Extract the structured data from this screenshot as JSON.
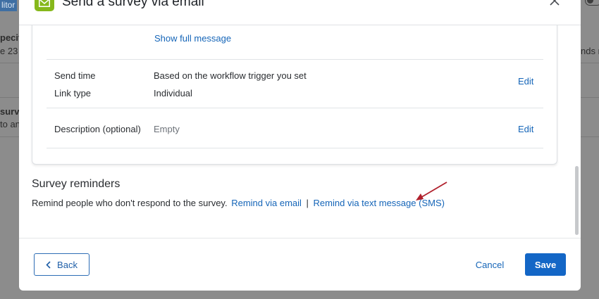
{
  "background": {
    "top_button_label": "litor",
    "fragments": [
      "pecifi",
      "e 23",
      "nds n",
      "surv",
      "to an"
    ],
    "toggle_icon": "toggle-icon"
  },
  "modal": {
    "title": "Send a survey via email",
    "icon": "envelope-icon",
    "close_icon": "close-icon",
    "accent_color": "#86b81b",
    "card": {
      "show_full_message": "Show full message",
      "rows": [
        {
          "label": "Send time",
          "value": "Based on the workflow trigger you set"
        },
        {
          "label": "Link type",
          "value": "Individual"
        },
        {
          "label": "Description (optional)",
          "value": "Empty"
        }
      ],
      "edit_label": "Edit"
    },
    "reminders": {
      "title": "Survey reminders",
      "text": "Remind people who don't respond to the survey.",
      "email_link": "Remind via email",
      "separator": "|",
      "sms_link": "Remind via text message (SMS)"
    },
    "footer": {
      "back_label": "Back",
      "cancel_label": "Cancel",
      "save_label": "Save",
      "save_color": "#1366c6"
    }
  },
  "annotation": {
    "arrow_color": "#b0202c"
  }
}
